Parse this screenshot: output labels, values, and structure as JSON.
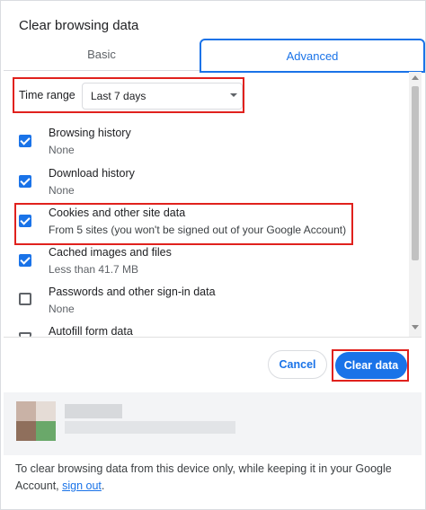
{
  "dialog": {
    "title": "Clear browsing data"
  },
  "tabs": [
    {
      "label": "Basic",
      "active": false
    },
    {
      "label": "Advanced",
      "active": true
    }
  ],
  "time_range": {
    "label": "Time range",
    "selected": "Last 7 days"
  },
  "items": [
    {
      "label": "Browsing history",
      "detail": "None",
      "checked": true
    },
    {
      "label": "Download history",
      "detail": "None",
      "checked": true
    },
    {
      "label": "Cookies and other site data",
      "detail": "From 5 sites (you won't be signed out of your Google Account)",
      "checked": true
    },
    {
      "label": "Cached images and files",
      "detail": "Less than 41.7 MB",
      "checked": true
    },
    {
      "label": "Passwords and other sign-in data",
      "detail": "None",
      "checked": false
    },
    {
      "label": "Autofill form data",
      "detail": "",
      "checked": false
    }
  ],
  "buttons": {
    "cancel": "Cancel",
    "clear": "Clear data"
  },
  "footer": {
    "text": "To clear browsing data from this device only, while keeping it in your Google Account,",
    "link": "sign out",
    "end": "."
  },
  "colors": {
    "accent": "#1a73e8",
    "highlight": "#e0211d"
  }
}
